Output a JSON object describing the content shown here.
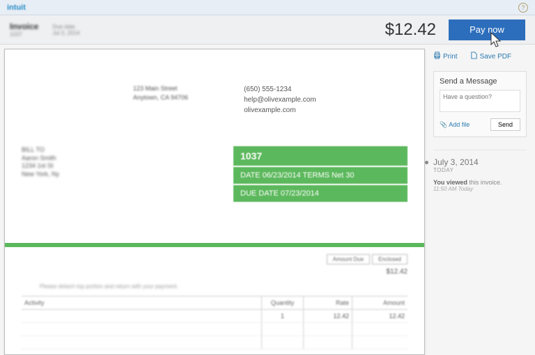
{
  "brand": "intuit",
  "header": {
    "title": "Invoice",
    "number": "1037",
    "due_label": "Due date",
    "due_date": "Jul 3, 2014",
    "amount": "$12.42",
    "pay_button": "Pay now"
  },
  "actions": {
    "print": "Print",
    "save_pdf": "Save PDF"
  },
  "message": {
    "title": "Send a Message",
    "placeholder": "Have a question?",
    "add_file": "Add file",
    "send": "Send"
  },
  "log": {
    "date": "July 3, 2014",
    "today_label": "TODAY",
    "entry_prefix": "You viewed",
    "entry_suffix": " this invoice.",
    "time": "11:50 AM Today"
  },
  "doc": {
    "from": {
      "line1": "123 Main Street",
      "line2": "Anytown, CA 94706"
    },
    "contact": {
      "phone": "(650) 555-1234",
      "email": "help@olivexample.com",
      "site": "olivexample.com"
    },
    "bill_to": {
      "label": "BILL TO",
      "name": "Aaron Smith",
      "addr1": "1234 1st St",
      "addr2": "New York, Ny"
    },
    "invoice_num": "1037",
    "date_row": "DATE 06/23/2014   TERMS Net 30",
    "due_row": "DUE DATE 07/23/2014",
    "amount_due_label": "Amount Due",
    "enclosed_label": "Enclosed",
    "amount_due_value": "$12.42",
    "note_text": "Please detach top portion and return with your payment.",
    "table": {
      "h_activity": "Activity",
      "h_qty": "Quantity",
      "h_rate": "Rate",
      "h_amount": "Amount",
      "rows": [
        {
          "activity": "",
          "qty": "1",
          "rate": "12.42",
          "amount": "12.42"
        }
      ]
    }
  }
}
